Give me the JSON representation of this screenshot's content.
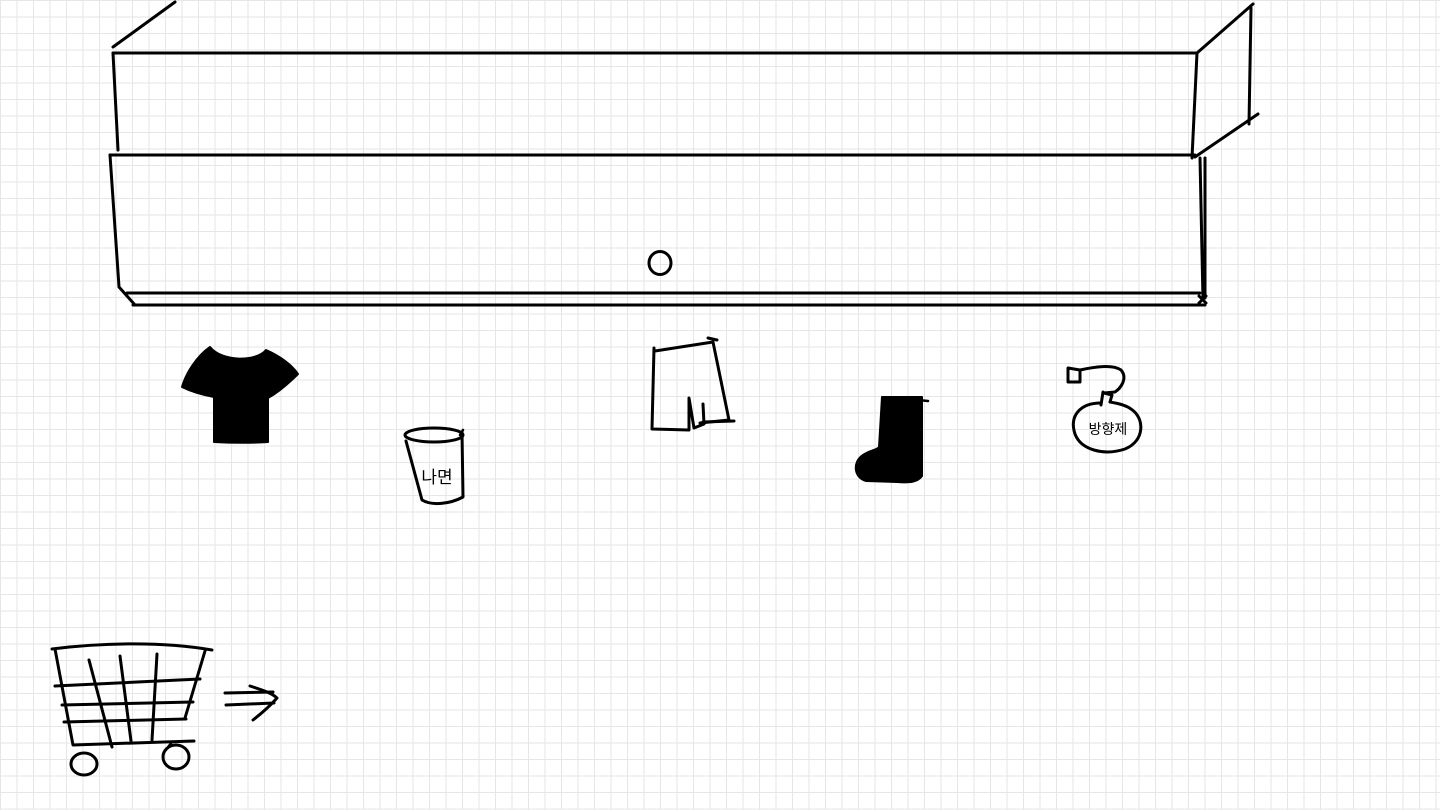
{
  "canvas": {
    "background": "#ffffff",
    "grid_color": "#e6e6e6",
    "ink_color": "#000000"
  },
  "items": {
    "cup": {
      "label": "나면"
    },
    "bottle": {
      "label": "방향제"
    }
  }
}
